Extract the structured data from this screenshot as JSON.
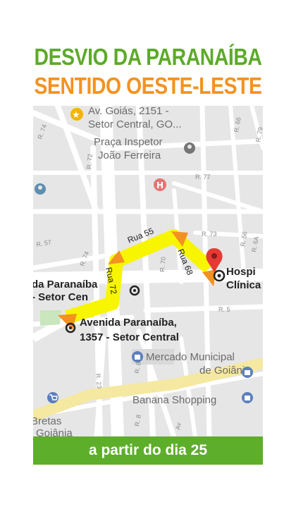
{
  "header": {
    "title": "DESVIO DA PARANAÍBA",
    "subtitle": "SENTIDO OESTE-LESTE"
  },
  "map": {
    "places": {
      "goias_line1": "Av. Goiás, 2151 -",
      "goias_line2": "Setor Central, GO...",
      "praca_line1": "Praça Inspetor",
      "praca_line2": "João Ferreira",
      "hospital_line1": "Hospi",
      "hospital_line2": "Clínica",
      "paranaiba_left_line1": "da Paranaíba",
      "paranaiba_left_line2": "- Setor Cen",
      "paranaiba_main_line1": "Avenida Paranaíba,",
      "paranaiba_main_line2": "1357 - Setor Central",
      "mercado_line1": "Mercado Municipal",
      "mercado_line2": "de Goiânia",
      "banana": "Banana Shopping",
      "bretas_line1": "Bretas",
      "bretas_line2": "Goiânia"
    },
    "roads": {
      "r74_top": "R. 74",
      "r72": "R. 72",
      "r79": "R. 79",
      "r77": "R. 77",
      "r66": "R. 66",
      "r73": "R. 73",
      "r57": "R. 57",
      "r74_mid": "R. 74",
      "r70": "R. 70",
      "r56": "R. 56",
      "r6a": "R. 6A",
      "r5": "R. 5",
      "r23": "R. 23",
      "r8": "R. 8",
      "r8b": "R. 8",
      "av": "Av"
    },
    "detour": {
      "rua55": "Rua 55",
      "rua72": "Rua 72",
      "rua68": "Rua 68"
    }
  },
  "footer": {
    "text": "a partir do dia 25"
  },
  "colors": {
    "title": "#5daa2a",
    "subtitle": "#f39221",
    "footer_bg": "#5dae2b",
    "detour": "#f7f500",
    "arrow": "#f39221",
    "hospital_pin": "#e53935"
  }
}
